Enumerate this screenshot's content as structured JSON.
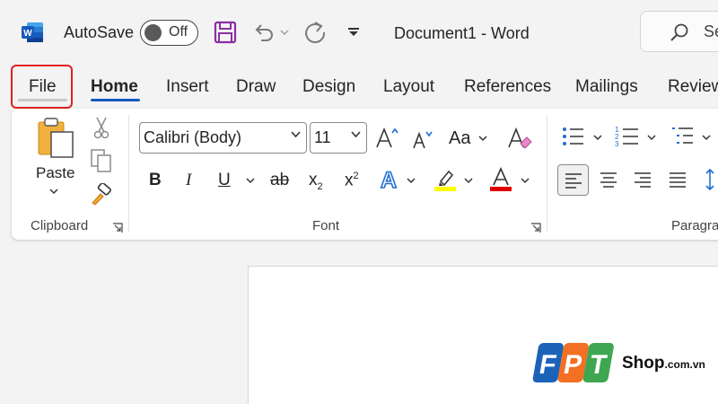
{
  "titlebar": {
    "autosave_label": "AutoSave",
    "autosave_state": "Off",
    "document_title": "Document1  -  Word",
    "search_placeholder": "Se"
  },
  "tabs": [
    "File",
    "Home",
    "Insert",
    "Draw",
    "Design",
    "Layout",
    "References",
    "Mailings",
    "Review"
  ],
  "active_tab": "Home",
  "highlighted_tab": "File",
  "ribbon": {
    "clipboard": {
      "paste_label": "Paste",
      "group_label": "Clipboard"
    },
    "font": {
      "font_name": "Calibri (Body)",
      "font_size": "11",
      "change_case_label": "Aa",
      "bold": "B",
      "italic": "I",
      "underline": "U",
      "strikethrough": "ab",
      "subscript": "x",
      "subscript_mark": "2",
      "superscript": "x",
      "superscript_mark": "2",
      "highlight_color": "#ffff00",
      "font_color": "#e00000",
      "group_label": "Font"
    },
    "paragraph": {
      "group_label": "Paragra"
    }
  },
  "watermark": {
    "logo_letters": [
      "F",
      "P",
      "T"
    ],
    "shop": "Shop",
    "domain": ".com.vn"
  },
  "colors": {
    "accent": "#185abd",
    "highlight_box": "#e02020",
    "word_blue": "#2b579a"
  }
}
